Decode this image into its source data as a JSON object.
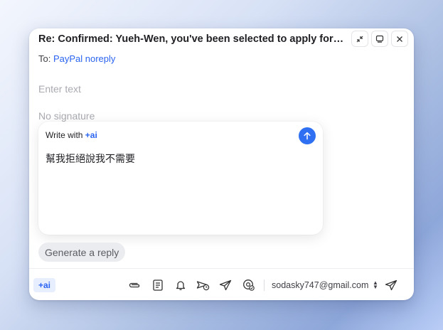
{
  "window": {
    "subject": "Re: Confirmed: Yueh-Wen, you've been selected to apply for ...",
    "to_label": "To:",
    "to_recipient": "PayPal noreply",
    "body_placeholder": "Enter text",
    "signature": "No signature"
  },
  "window_controls": {
    "icons": [
      "collapse-icon",
      "expand-icon",
      "close-icon"
    ]
  },
  "ai_panel": {
    "title_prefix": "Write with ",
    "brand": "+ai",
    "prompt_text": "幫我拒絕說我不需要",
    "generate_label": "Generate a reply"
  },
  "toolbar": {
    "ai_label": "+ai",
    "icons": [
      "paperclip-icon",
      "template-icon",
      "bell-icon",
      "schedule-send-icon",
      "send-later-icon",
      "tracking-icon",
      "send-icon"
    ],
    "sender": "sodasky747@gmail.com",
    "sender_chevron": "▲▼"
  },
  "colors": {
    "accent": "#2a64f0",
    "send_button": "#2f70f2"
  }
}
